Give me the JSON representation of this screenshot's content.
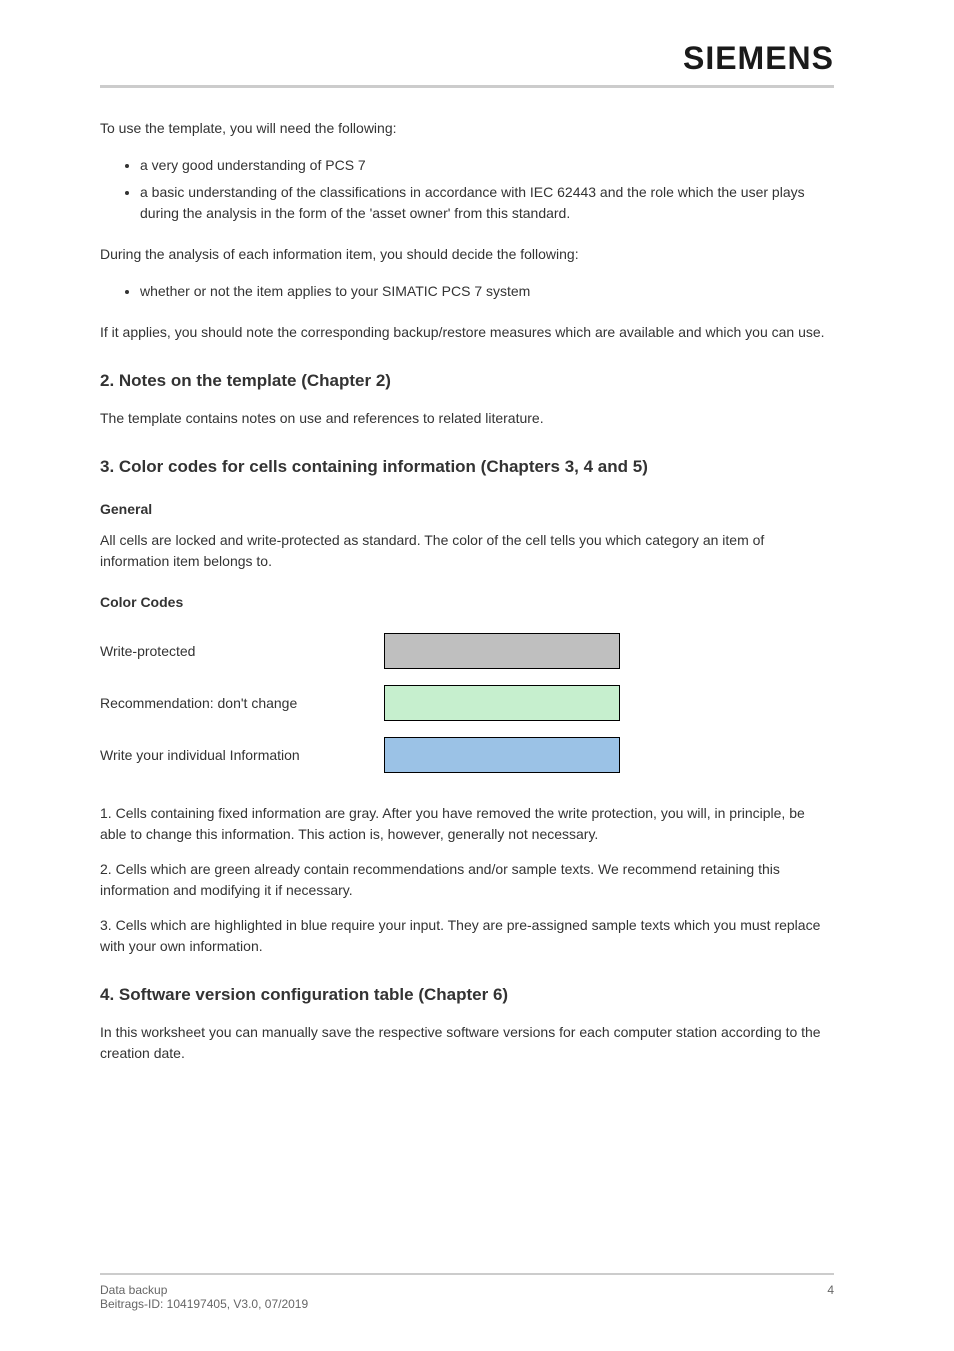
{
  "brand": "SIEMENS",
  "intro_para": "To use the template, you will need the following:",
  "bullets_intro": [
    "a very good understanding of PCS 7",
    "a basic understanding of the classifications in accordance with IEC 62443 and the role which the user plays during the analysis in the form of the 'asset owner' from this standard."
  ],
  "secondary_para": "During the analysis of each information item, you should decide the following:",
  "bullets_secondary": [
    "whether or not the item applies to your SIMATIC PCS 7 system"
  ],
  "tertiary_para": "If it applies, you should note the corresponding backup/restore measures which are available and which you can use.",
  "heading_template": "2. Notes on the template (Chapter 2)",
  "note_template": "The template contains notes on use and references to related literature.",
  "heading_color": "3. Color codes for cells containing information (Chapters 3, 4 and 5)",
  "subheading_general": "General",
  "general_text": "All cells are locked and write-protected as standard. The color of the cell tells you which category an item of information item belongs to.",
  "subheading_codes": "Color Codes",
  "swatches": [
    {
      "label": "Write-protected",
      "class": "swatch-gray"
    },
    {
      "label": "Recommendation: don't change",
      "class": "swatch-green"
    },
    {
      "label": "Write your individual Information",
      "class": "swatch-blue"
    }
  ],
  "code_items": [
    {
      "num": "1.",
      "text": "Cells containing fixed information are gray. After you have removed the write protection, you will, in principle, be able to change this information. This action is, however, generally not necessary."
    },
    {
      "num": "2.",
      "text": "Cells which are green already contain recommendations and/or sample texts. We recommend retaining this information and modifying it if necessary."
    },
    {
      "num": "3.",
      "text": "Cells which are highlighted in blue require your input. They are pre-assigned sample texts which you must replace with your own information."
    }
  ],
  "heading_config": "4. Software version configuration table (Chapter 6)",
  "config_text": "In this worksheet you can manually save the respective software versions for each computer station according to the creation date.",
  "footer": {
    "left_line1": "Data backup",
    "left_line2": "Beitrags-ID: 104197405,    V3.0,    07/2019",
    "right": "4"
  }
}
